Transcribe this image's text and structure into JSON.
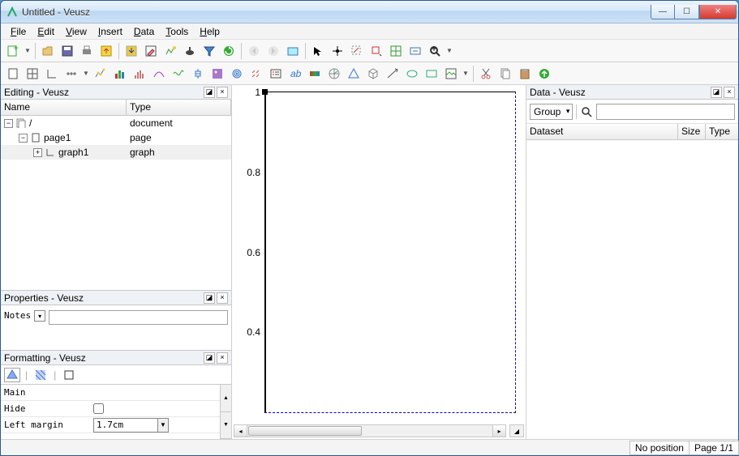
{
  "window": {
    "title": "Untitled - Veusz"
  },
  "menu": {
    "file": "File",
    "edit": "Edit",
    "view": "View",
    "insert": "Insert",
    "data": "Data",
    "tools": "Tools",
    "help": "Help"
  },
  "panels": {
    "editing_title": "Editing - Veusz",
    "properties_title": "Properties - Veusz",
    "formatting_title": "Formatting - Veusz",
    "data_title": "Data - Veusz"
  },
  "tree": {
    "col_name": "Name",
    "col_type": "Type",
    "rows": [
      {
        "name": "/",
        "type": "document"
      },
      {
        "name": "page1",
        "type": "page"
      },
      {
        "name": "graph1",
        "type": "graph"
      }
    ]
  },
  "properties": {
    "notes_label": "Notes",
    "notes_value": ""
  },
  "formatting": {
    "main_label": "Main",
    "hide_label": "Hide",
    "left_margin_label": "Left margin",
    "left_margin_value": "1.7cm"
  },
  "plot": {
    "yticks": [
      "1",
      "0.8",
      "0.6",
      "0.4"
    ]
  },
  "data_panel": {
    "group_label": "Group",
    "col_dataset": "Dataset",
    "col_size": "Size",
    "col_type": "Type"
  },
  "status": {
    "pos": "No position",
    "page": "Page 1/1"
  }
}
